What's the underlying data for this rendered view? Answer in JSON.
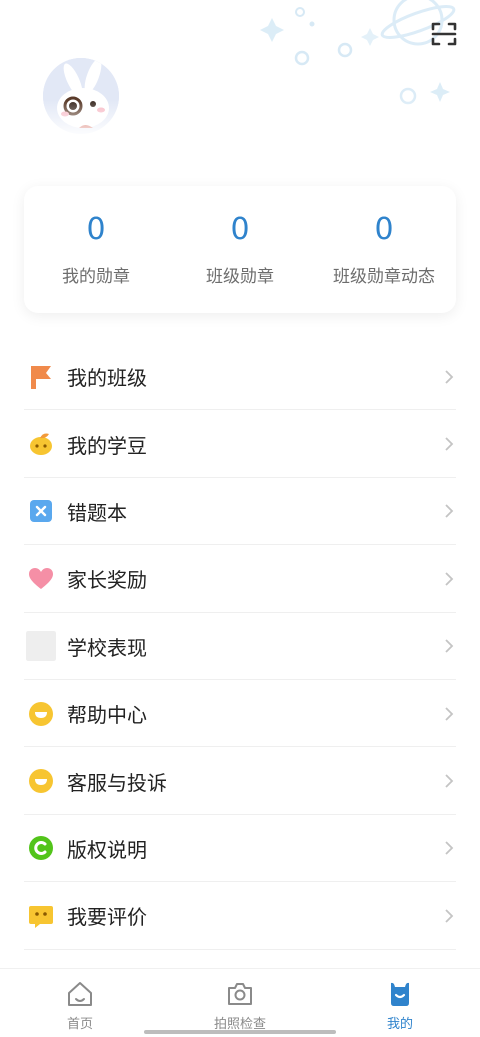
{
  "colors": {
    "accent": "#2f83cc",
    "tab_active": "#2f83cc",
    "tab_inactive": "#8a8a8a"
  },
  "stats": [
    {
      "value": "0",
      "label": "我的勋章"
    },
    {
      "value": "0",
      "label": "班级勋章"
    },
    {
      "value": "0",
      "label": "班级勋章动态"
    }
  ],
  "menu": [
    {
      "label": "我的班级",
      "icon": "flag-icon"
    },
    {
      "label": "我的学豆",
      "icon": "bean-icon"
    },
    {
      "label": "错题本",
      "icon": "wrong-book-icon"
    },
    {
      "label": "家长奖励",
      "icon": "heart-icon"
    },
    {
      "label": "学校表现",
      "icon": "school-performance-icon"
    },
    {
      "label": "帮助中心",
      "icon": "help-icon"
    },
    {
      "label": "客服与投诉",
      "icon": "service-icon"
    },
    {
      "label": "版权说明",
      "icon": "copyright-icon"
    },
    {
      "label": "我要评价",
      "icon": "review-icon"
    }
  ],
  "tabs": [
    {
      "label": "首页",
      "icon": "home-icon",
      "active": false
    },
    {
      "label": "拍照检查",
      "icon": "camera-icon",
      "active": false
    },
    {
      "label": "我的",
      "icon": "profile-icon",
      "active": true
    }
  ]
}
